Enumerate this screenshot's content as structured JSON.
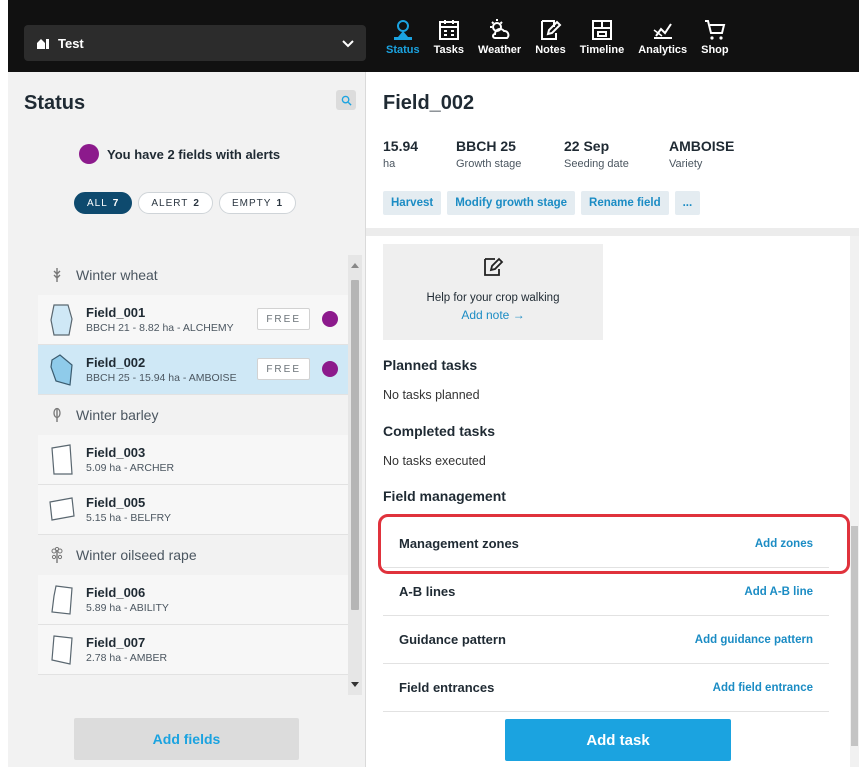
{
  "header": {
    "farm_name": "Test",
    "nav": [
      {
        "label": "Status",
        "icon": "status-icon",
        "active": true
      },
      {
        "label": "Tasks",
        "icon": "tasks-icon"
      },
      {
        "label": "Weather",
        "icon": "weather-icon"
      },
      {
        "label": "Notes",
        "icon": "notes-icon"
      },
      {
        "label": "Timeline",
        "icon": "timeline-icon"
      },
      {
        "label": "Analytics",
        "icon": "analytics-icon"
      },
      {
        "label": "Shop",
        "icon": "shop-icon"
      }
    ]
  },
  "status": {
    "title": "Status",
    "alert_text": "You have 2 fields with alerts",
    "filters": [
      {
        "label": "ALL",
        "count": "7"
      },
      {
        "label": "ALERT",
        "count": "2"
      },
      {
        "label": "EMPTY",
        "count": "1"
      }
    ],
    "groups": [
      {
        "crop": "Winter wheat",
        "fields": [
          {
            "name": "Field_001",
            "meta": "BBCH 21 - 8.82 ha - ALCHEMY",
            "badge": "FREE"
          },
          {
            "name": "Field_002",
            "meta": "BBCH 25 - 15.94 ha - AMBOISE",
            "badge": "FREE"
          }
        ]
      },
      {
        "crop": "Winter barley",
        "fields": [
          {
            "name": "Field_003",
            "meta": "5.09 ha - ARCHER"
          },
          {
            "name": "Field_005",
            "meta": "5.15 ha - BELFRY"
          }
        ]
      },
      {
        "crop": "Winter oilseed rape",
        "fields": [
          {
            "name": "Field_006",
            "meta": "5.89 ha - ABILITY"
          },
          {
            "name": "Field_007",
            "meta": "2.78 ha - AMBER"
          }
        ]
      }
    ],
    "add_fields_label": "Add fields"
  },
  "field": {
    "title": "Field_002",
    "stats": [
      {
        "value": "15.94",
        "label": "ha"
      },
      {
        "value": "BBCH 25",
        "label": "Growth stage"
      },
      {
        "value": "22 Sep",
        "label": "Seeding date"
      },
      {
        "value": "AMBOISE",
        "label": "Variety"
      }
    ],
    "actions": [
      "Harvest",
      "Modify growth stage",
      "Rename field",
      "..."
    ],
    "help_card": {
      "text": "Help for your crop walking",
      "link": "Add note →"
    },
    "planned_title": "Planned tasks",
    "planned_text": "No tasks planned",
    "completed_title": "Completed tasks",
    "completed_text": "No tasks executed",
    "management_title": "Field management",
    "management_rows": [
      {
        "name": "Management zones",
        "link": "Add zones"
      },
      {
        "name": "A-B lines",
        "link": "Add A-B line"
      },
      {
        "name": "Guidance pattern",
        "link": "Add guidance pattern"
      },
      {
        "name": "Field entrances",
        "link": "Add field entrance"
      }
    ],
    "add_task_label": "Add task"
  },
  "colors": {
    "accent": "#1ba3e0",
    "alert": "#8c1a8c",
    "highlight": "#e0323c"
  }
}
